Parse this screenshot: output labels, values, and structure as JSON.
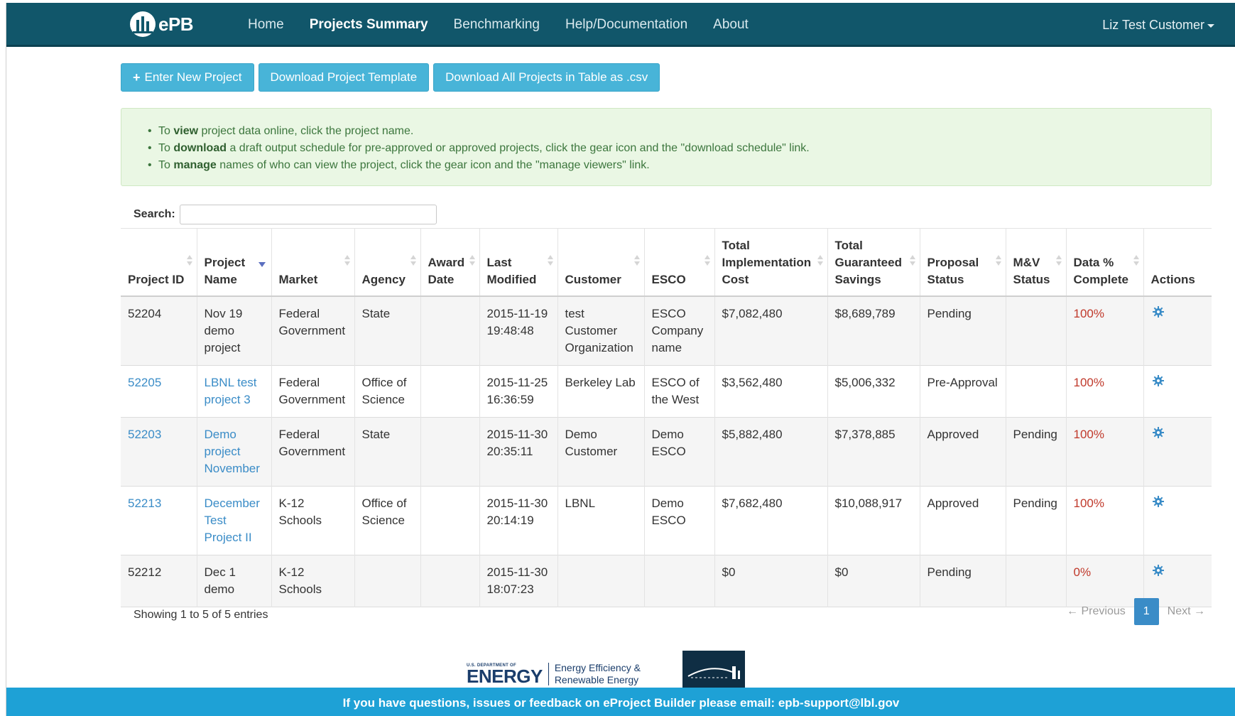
{
  "brand": {
    "name": "ePB"
  },
  "nav": {
    "items": [
      {
        "label": "Home",
        "active": false
      },
      {
        "label": "Projects Summary",
        "active": true
      },
      {
        "label": "Benchmarking",
        "active": false
      },
      {
        "label": "Help/Documentation",
        "active": false
      },
      {
        "label": "About",
        "active": false
      }
    ],
    "user": "Liz Test Customer"
  },
  "actions": {
    "new_project": "Enter New Project",
    "download_template": "Download Project Template",
    "download_csv": "Download All Projects in Table as .csv"
  },
  "info": {
    "lines": [
      {
        "pre": "To ",
        "bold": "view",
        "post": " project data online, click the project name."
      },
      {
        "pre": "To ",
        "bold": "download",
        "post": " a draft output schedule for pre-approved or approved projects, click the gear icon and the \"download schedule\" link."
      },
      {
        "pre": "To ",
        "bold": "manage",
        "post": " names of who can view the project, click the gear icon and the \"manage viewers\" link."
      }
    ]
  },
  "search": {
    "label": "Search:",
    "value": "",
    "placeholder": ""
  },
  "table": {
    "columns": [
      "Project ID",
      "Project Name",
      "Market",
      "Agency",
      "Award Date",
      "Last Modified",
      "Customer",
      "ESCO",
      "Total Implementation Cost",
      "Total Guaranteed Savings",
      "Proposal Status",
      "M&V Status",
      "Data % Complete",
      "Actions"
    ],
    "rows": [
      {
        "id": "52204",
        "name": "Nov 19 demo project",
        "linked": false,
        "market": "Federal Government",
        "agency": "State",
        "award_date": "",
        "modified": "2015-11-19 19:48:48",
        "customer": "test Customer Organization",
        "esco": "ESCO Company name",
        "cost": "$7,082,480",
        "savings": "$8,689,789",
        "proposal": "Pending",
        "mv": "",
        "pct": "100%"
      },
      {
        "id": "52205",
        "name": "LBNL test project 3",
        "linked": true,
        "market": "Federal Government",
        "agency": "Office of Science",
        "award_date": "",
        "modified": "2015-11-25 16:36:59",
        "customer": "Berkeley Lab",
        "esco": "ESCO of the West",
        "cost": "$3,562,480",
        "savings": "$5,006,332",
        "proposal": "Pre-Approval",
        "mv": "",
        "pct": "100%"
      },
      {
        "id": "52203",
        "name": "Demo project November",
        "linked": true,
        "market": "Federal Government",
        "agency": "State",
        "award_date": "",
        "modified": "2015-11-30 20:35:11",
        "customer": "Demo Customer",
        "esco": "Demo ESCO",
        "cost": "$5,882,480",
        "savings": "$7,378,885",
        "proposal": "Approved",
        "mv": "Pending",
        "pct": "100%"
      },
      {
        "id": "52213",
        "name": "December Test Project II",
        "linked": true,
        "market": "K-12 Schools",
        "agency": "Office of Science",
        "award_date": "",
        "modified": "2015-11-30 20:14:19",
        "customer": "LBNL",
        "esco": "Demo ESCO",
        "cost": "$7,682,480",
        "savings": "$10,088,917",
        "proposal": "Approved",
        "mv": "Pending",
        "pct": "100%"
      },
      {
        "id": "52212",
        "name": "Dec 1 demo",
        "linked": false,
        "market": "K-12 Schools",
        "agency": "",
        "award_date": "",
        "modified": "2015-11-30 18:07:23",
        "customer": "",
        "esco": "",
        "cost": "$0",
        "savings": "$0",
        "proposal": "Pending",
        "mv": "",
        "pct": "0%"
      }
    ]
  },
  "table_info": "Showing 1 to 5 of 5 entries",
  "pager": {
    "prev": "← Previous",
    "current": "1",
    "next": "Next →"
  },
  "logos": {
    "doe_small": "U.S. DEPARTMENT OF",
    "doe_big": "ENERGY",
    "ee_line1": "Energy Efficiency &",
    "ee_line2": "Renewable Energy"
  },
  "footer": "If you have questions, issues or feedback on eProject Builder please email: epb-support@lbl.gov",
  "colors": {
    "navbar": "#11566a",
    "button": "#48b4d8",
    "link": "#3a8cc7",
    "pct": "#c0392b",
    "footer": "#1ea1d6"
  }
}
